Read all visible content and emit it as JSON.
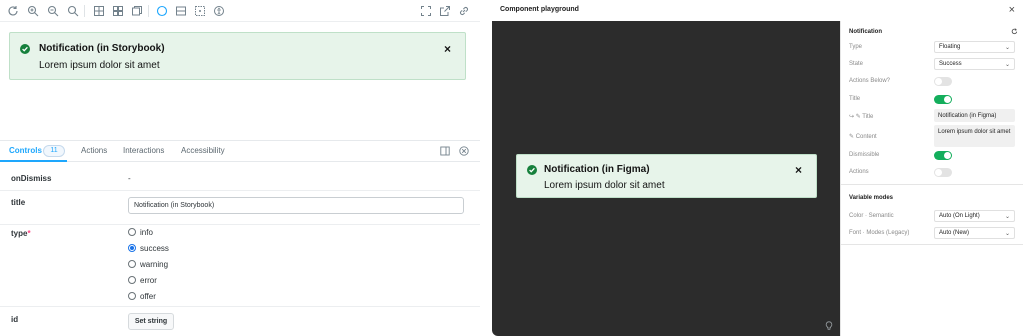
{
  "storybook": {
    "toolbar_icons": [
      "reload-icon",
      "zoom-in-icon",
      "zoom-out-icon",
      "zoom-reset-icon",
      "grid-icon",
      "background-icon",
      "viewport-icon",
      "outline-icon",
      "measure-icon",
      "ruler-icon",
      "accessibility-icon",
      "fullscreen-icon",
      "open-new-tab-icon",
      "copy-link-icon"
    ],
    "preview": {
      "notification_title": "Notification (in Storybook)",
      "notification_body": "Lorem ipsum dolor sit amet",
      "close_glyph": "×"
    },
    "tabs": {
      "controls_label": "Controls",
      "controls_count": "11",
      "actions_label": "Actions",
      "interactions_label": "Interactions",
      "accessibility_label": "Accessibility"
    },
    "controls": {
      "onDismiss_label": "onDismiss",
      "onDismiss_value": "-",
      "title_label": "title",
      "title_value": "Notification (in Storybook)",
      "type_label": "type",
      "type_required": "*",
      "type_options": [
        "info",
        "success",
        "warning",
        "error",
        "offer"
      ],
      "type_selected": "success",
      "id_label": "id",
      "id_button": "Set string"
    }
  },
  "figma": {
    "header_title": "Component playground",
    "close_glyph": "×",
    "preview": {
      "notification_title": "Notification (in Figma)",
      "notification_body": "Lorem ipsum dolor sit amet",
      "close_glyph": "×"
    },
    "properties": {
      "section_title": "Notification",
      "type_label": "Type",
      "type_value": "Floating",
      "state_label": "State",
      "state_value": "Success",
      "actions_below_label": "Actions Below?",
      "actions_below_on": false,
      "title_label": "Title",
      "title_on": true,
      "title_text_label": "↪ ✎ Title",
      "title_text_value": "Notification (in Figma)",
      "content_label": "✎ Content",
      "content_value": "Lorem ipsum dolor sit amet",
      "dismissible_label": "Dismissible",
      "dismissible_on": true,
      "actions_label": "Actions",
      "actions_on": false
    },
    "variable_modes": {
      "section_title": "Variable modes",
      "color_label": "Color · Semantic",
      "color_value": "Auto (On Light)",
      "font_label": "Font · Modes (Legacy)",
      "font_value": "Auto (New)"
    }
  },
  "colors": {
    "notification_bg": "#e7f4ea",
    "success_green": "#16803c",
    "storybook_accent": "#1ea7fd",
    "toggle_on": "#14ae5c",
    "figma_canvas": "#2c2c2c"
  }
}
